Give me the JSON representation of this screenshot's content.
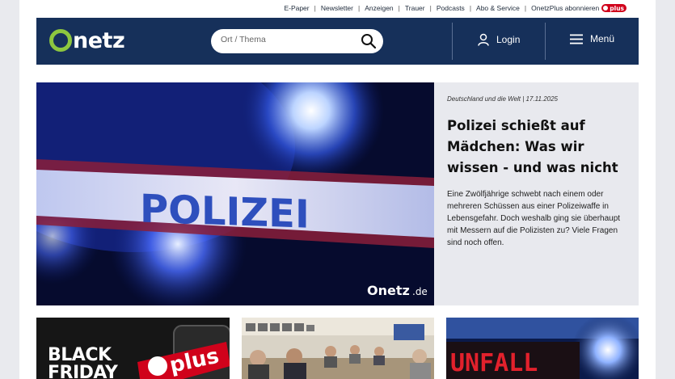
{
  "toplinks": [
    "E-Paper",
    "Newsletter",
    "Anzeigen",
    "Trauer",
    "Podcasts",
    "Abo & Service",
    "OnetzPlus abonnieren"
  ],
  "plus_badge": "plus",
  "header": {
    "logo_text": "netz",
    "search_placeholder": "Ort / Thema",
    "login_label": "Login",
    "menu_label": "Menü",
    "bg_color": "#16305a",
    "logo_accent": "#8dc63f"
  },
  "hero": {
    "image_text": "POLIZEI",
    "image_watermark": "Onetz",
    "image_watermark_suffix": ".de",
    "meta": "Deutschland und die Welt | 17.11.2025",
    "headline": "Polizei schießt auf Mädchen: Was wir wissen - und was nicht",
    "teaser": "Eine Zwölfjährige schwebt nach einem oder mehreren Schüssen aus einer Polizeiwaffe in Lebensgefahr. Doch weshalb ging sie überhaupt mit Messern auf die Polizisten zu? Viele Fragen sind noch offen."
  },
  "cards": {
    "card1_text_line1": "BLACK",
    "card1_text_line2": "FRIDAY",
    "card1_badge": "plus",
    "card3_sign": "UNFALL"
  }
}
